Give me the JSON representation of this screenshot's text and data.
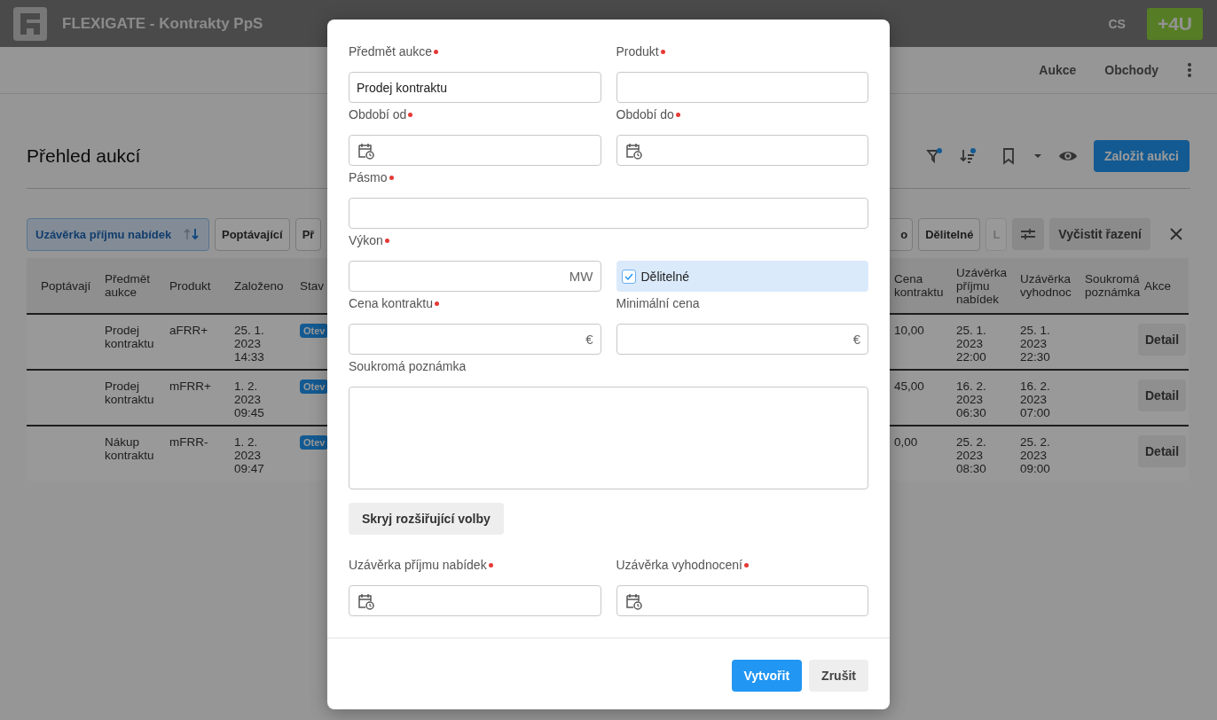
{
  "app_bar": {
    "title": "FLEXIGATE - Kontrakty PpS",
    "language": "CS",
    "brand": "+4U"
  },
  "nav": [
    {
      "label": "Aukce"
    },
    {
      "label": "Obchody"
    }
  ],
  "page": {
    "title": "Přehled aukcí",
    "create_button": "Založit aukci",
    "filter_active": true,
    "sort_active": true
  },
  "sort_chips_left": [
    {
      "label": "Uzávěrka příjmu nabídek",
      "selected": true,
      "disabled": false
    },
    {
      "label": "Poptávající",
      "selected": false,
      "disabled": false
    },
    {
      "label": "Př",
      "selected": false,
      "disabled": false
    }
  ],
  "sort_chips_right": [
    {
      "label": "o",
      "selected": false,
      "disabled": false
    },
    {
      "label": "Dělitelné",
      "selected": false,
      "disabled": false
    },
    {
      "label": "L",
      "selected": false,
      "disabled": true
    }
  ],
  "clear_sort_button": "Vyčistit řazení",
  "table": {
    "columns_left": [
      "Poptávají",
      "Předmět aukce",
      "Produkt",
      "Založeno",
      "Stav"
    ],
    "columns_right": [
      "Cena kontraktu",
      "Uzávěrka příjmu nabídek",
      "Uzávěrka vyhodnoc",
      "Soukromá poznámka",
      "Akce"
    ],
    "rows": [
      {
        "subject": "Prodej kontraktu",
        "product": "aFRR+",
        "created": "25. 1. 2023 14:33",
        "status": "Otev",
        "price": "10,00",
        "bid_close": "25. 1. 2023 22:00",
        "eval_close": "25. 1. 2023 22:30",
        "action": "Detail"
      },
      {
        "subject": "Prodej kontraktu",
        "product": "mFRR+",
        "created": "1. 2. 2023 09:45",
        "status": "Otev",
        "price": "45,00",
        "bid_close": "16. 2. 2023 06:30",
        "eval_close": "16. 2. 2023 07:00",
        "action": "Detail"
      },
      {
        "subject": "Nákup kontraktu",
        "product": "mFRR-",
        "created": "1. 2. 2023 09:47",
        "status": "Otev",
        "price": "0,00",
        "bid_close": "25. 2. 2023 08:30",
        "eval_close": "25. 2. 2023 09:00",
        "action": "Detail"
      }
    ]
  },
  "dialog": {
    "rows": [
      [
        {
          "kind": "text",
          "label": "Předmět aukce",
          "required": true,
          "value": "Prodej kontraktu"
        },
        {
          "kind": "text",
          "label": "Produkt",
          "required": true
        }
      ],
      [
        {
          "kind": "date",
          "label": "Období od",
          "required": true
        },
        {
          "kind": "date",
          "label": "Období do",
          "required": true
        }
      ],
      [
        {
          "kind": "text",
          "label": "Pásmo",
          "required": true
        }
      ],
      [
        {
          "kind": "unit",
          "label": "Výkon",
          "required": true,
          "unit": "MW"
        },
        {
          "kind": "checkbox",
          "label": "Dělitelné",
          "checked": true
        }
      ],
      [
        {
          "kind": "unit",
          "label": "Cena kontraktu",
          "required": true,
          "unit": "€"
        },
        {
          "kind": "unit",
          "label": "Minimální cena",
          "required": false,
          "unit": "€"
        }
      ],
      [
        {
          "kind": "textarea",
          "label": "Soukromá poznámka",
          "required": false
        }
      ]
    ],
    "toggle_button": "Skryj rozšiřující volby",
    "rows_extra": [
      [
        {
          "kind": "date",
          "label": "Uzávěrka příjmu nabídek",
          "required": true
        },
        {
          "kind": "date",
          "label": "Uzávěrka vyhodnocení",
          "required": true
        }
      ]
    ],
    "buttons": [
      {
        "label": "Vytvořit",
        "kind": "primary"
      },
      {
        "label": "Zrušit",
        "kind": "secondary"
      }
    ]
  }
}
